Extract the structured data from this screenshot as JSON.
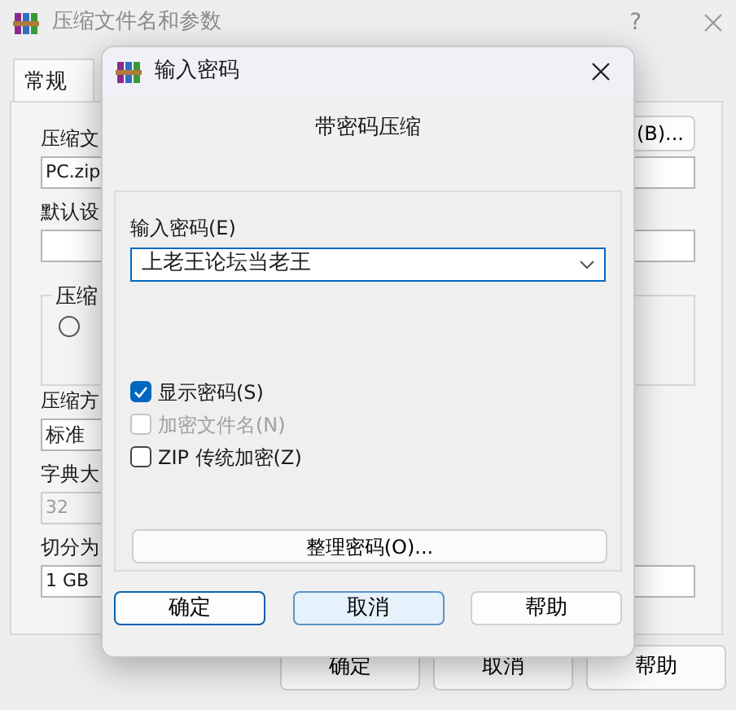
{
  "background_window": {
    "title": "压缩文件名和参数",
    "help": "?",
    "tabs": [
      {
        "label": "常规",
        "selected": true
      }
    ],
    "archive_name_label": "压缩文",
    "browse_button": "(B)...",
    "archive_name": "PC.zip",
    "profile_label": "默认设",
    "group_label": "压缩",
    "radio_selected": false,
    "method_label": "压缩方",
    "method": "标准",
    "dictionary_label": "字典大",
    "dictionary": "32",
    "split_label": "切分为",
    "split": "1 GB",
    "buttons": [
      "确定",
      "取消",
      "帮助"
    ]
  },
  "dialog": {
    "title": "输入密码",
    "heading": "带密码压缩",
    "password_label": "输入密码(E)",
    "password": "上老王论坛当老王",
    "options": [
      {
        "label": "显示密码(S)",
        "checked": true,
        "disabled": false
      },
      {
        "label": "加密文件名(N)",
        "checked": false,
        "disabled": true
      },
      {
        "label": "ZIP 传统加密(Z)",
        "checked": false,
        "disabled": false
      }
    ],
    "organize_button": "整理密码(O)...",
    "buttons": [
      {
        "label": "确定",
        "default": true,
        "hovered": false
      },
      {
        "label": "取消",
        "default": false,
        "hovered": true
      },
      {
        "label": "帮助",
        "default": false,
        "hovered": false
      }
    ]
  }
}
